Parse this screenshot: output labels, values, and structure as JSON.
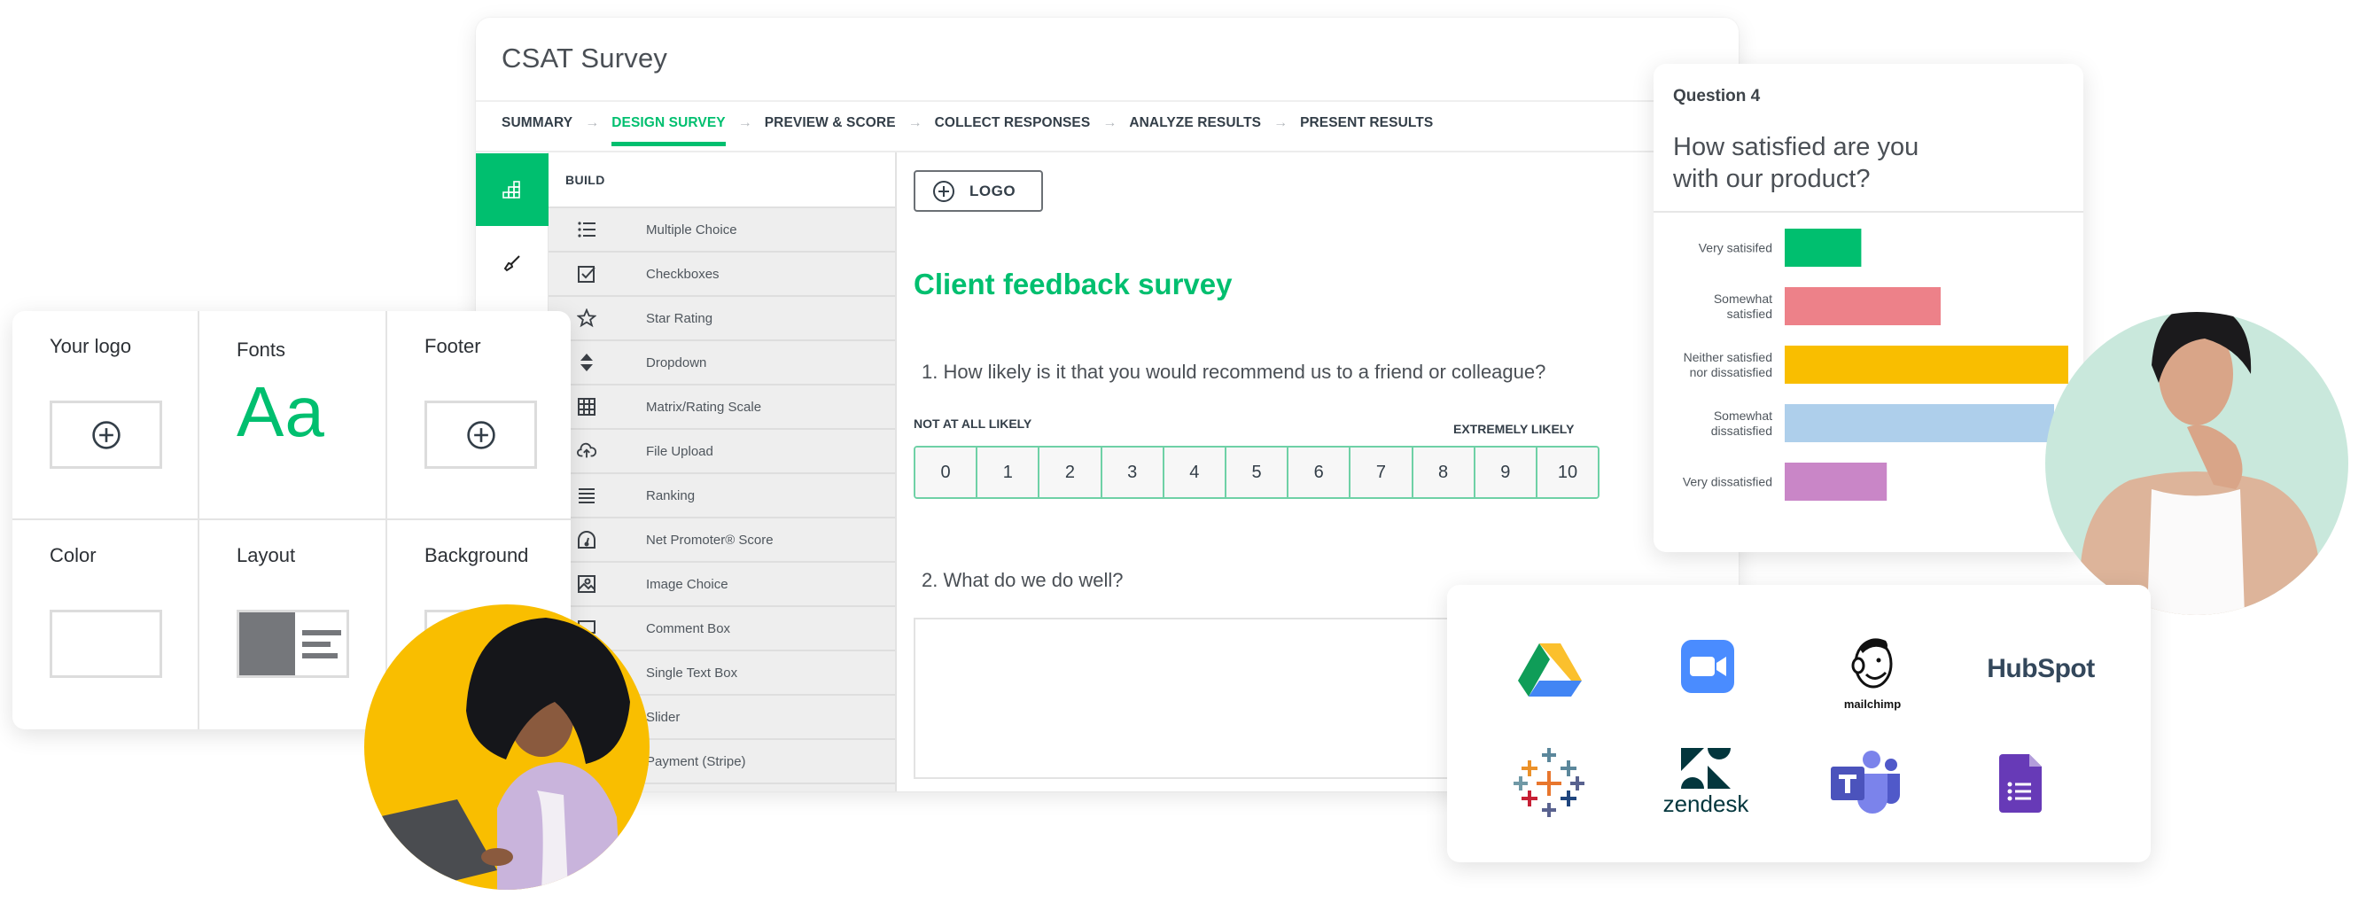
{
  "window": {
    "title": "CSAT Survey",
    "steps": [
      {
        "label": "SUMMARY",
        "active": false
      },
      {
        "label": "DESIGN SURVEY",
        "active": true
      },
      {
        "label": "PREVIEW & SCORE",
        "active": false
      },
      {
        "label": "COLLECT RESPONSES",
        "active": false
      },
      {
        "label": "ANALYZE RESULTS",
        "active": false
      },
      {
        "label": "PRESENT RESULTS",
        "active": false
      }
    ],
    "step_arrow": "→"
  },
  "rail": [
    {
      "icon": "build-blocks-icon",
      "active": true
    },
    {
      "icon": "paintbrush-icon",
      "active": false
    }
  ],
  "build": {
    "header": "BUILD",
    "items": [
      {
        "label": "Multiple Choice",
        "icon": "list-icon"
      },
      {
        "label": "Checkboxes",
        "icon": "checkbox-icon"
      },
      {
        "label": "Star Rating",
        "icon": "star-icon"
      },
      {
        "label": "Dropdown",
        "icon": "dropdown-icon"
      },
      {
        "label": "Matrix/Rating Scale",
        "icon": "grid-icon"
      },
      {
        "label": "File Upload",
        "icon": "cloud-upload-icon"
      },
      {
        "label": "Ranking",
        "icon": "ranking-icon"
      },
      {
        "label": "Net Promoter® Score",
        "icon": "gauge-icon"
      },
      {
        "label": "Image Choice",
        "icon": "image-icon"
      },
      {
        "label": "Comment Box",
        "icon": "comment-icon"
      },
      {
        "label": "Single Text Box",
        "icon": "textbox-icon"
      },
      {
        "label": "Slider",
        "icon": "slider-icon"
      },
      {
        "label": "Payment (Stripe)",
        "icon": "payment-icon"
      }
    ]
  },
  "canvas": {
    "logo_button": "LOGO",
    "survey_title": "Client feedback survey",
    "question1": "1. How likely is it that you would recommend us to a friend or colleague?",
    "scale_low": "NOT AT ALL LIKELY",
    "scale_high": "EXTREMELY LIKELY",
    "scale_values": [
      "0",
      "1",
      "2",
      "3",
      "4",
      "5",
      "6",
      "7",
      "8",
      "9",
      "10"
    ],
    "question2": "2. What do we do well?",
    "comment_value": ""
  },
  "customize": {
    "cells": [
      {
        "label": "Your logo",
        "kind": "add"
      },
      {
        "label": "Fonts",
        "kind": "font",
        "sample": "Aa"
      },
      {
        "label": "Footer",
        "kind": "add"
      },
      {
        "label": "Color",
        "kind": "color"
      },
      {
        "label": "Layout",
        "kind": "layout"
      },
      {
        "label": "Background",
        "kind": "add"
      }
    ],
    "palette": [
      "#1f4e3d",
      "#00bf6f",
      "#c8e8da",
      "#f3f7f5"
    ]
  },
  "results": {
    "question_number": "Question 4",
    "question": "How satisfied are you with our product?"
  },
  "chart_data": {
    "type": "bar",
    "orientation": "horizontal",
    "title": "How satisfied are you with our product?",
    "categories": [
      "Very satisifed",
      "Somewhat satisfied",
      "Neither satisfied nor dissatisfied",
      "Somewhat dissatisfied",
      "Very dissatisfied"
    ],
    "values": [
      27,
      55,
      100,
      95,
      36
    ],
    "value_unit": "relative % of largest bar (no axis shown)",
    "colors": [
      "#00bf6f",
      "#ed8189",
      "#f9be00",
      "#aecfeb",
      "#c986c7"
    ],
    "xlabel": "",
    "ylabel": "",
    "xlim": [
      0,
      100
    ],
    "grid": false,
    "legend": "none"
  },
  "integrations": [
    {
      "name": "Google Drive",
      "icon": "google-drive-icon"
    },
    {
      "name": "Zoom",
      "icon": "zoom-icon"
    },
    {
      "name": "mailchimp",
      "icon": "mailchimp-icon"
    },
    {
      "name": "HubSpot",
      "icon": "hubspot-icon"
    },
    {
      "name": "Tableau",
      "icon": "tableau-icon"
    },
    {
      "name": "zendesk",
      "icon": "zendesk-icon"
    },
    {
      "name": "Microsoft Teams",
      "icon": "teams-icon"
    },
    {
      "name": "Google Forms",
      "icon": "google-forms-icon"
    }
  ],
  "colors": {
    "accent": "#00bf6f",
    "text": "#333e48",
    "yellow": "#f9be00",
    "mint": "#c9e8dc"
  }
}
